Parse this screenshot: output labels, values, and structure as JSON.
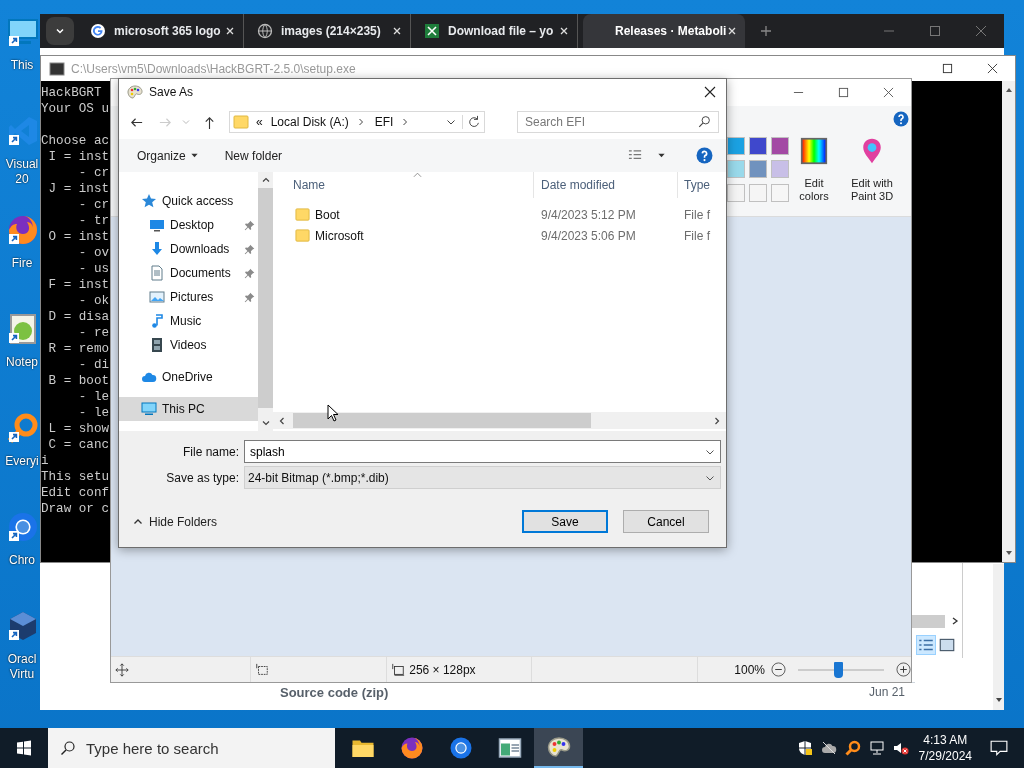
{
  "desktop_icons": [
    {
      "kind": "computer",
      "labels": [
        "This"
      ]
    },
    {
      "kind": "ribbon-app",
      "labels": [
        "Visual",
        "20"
      ]
    },
    {
      "kind": "fox-globe",
      "labels": [
        "Fire"
      ]
    },
    {
      "kind": "notepad",
      "labels": [
        "Notep"
      ]
    },
    {
      "kind": "magnifier-app",
      "labels": [
        "Everyi"
      ]
    },
    {
      "kind": "circle-app",
      "labels": [
        "Chro"
      ]
    },
    {
      "kind": "cube",
      "labels": [
        "Oracl",
        "Virtu"
      ]
    }
  ],
  "browser": {
    "tabs": [
      {
        "kind": "google",
        "label": "microsoft 365 logo",
        "selected": false
      },
      {
        "kind": "globe",
        "label": "images (214×235)",
        "selected": false
      },
      {
        "kind": "sheet",
        "label": "Download file – yo",
        "selected": false
      },
      {
        "kind": "none",
        "label": "Releases · Metaboli",
        "selected": true
      }
    ],
    "rows": [
      {
        "name": "Source code (zip)",
        "date": "Jun 21"
      }
    ]
  },
  "console": {
    "title": "C:\\Users\\vm5\\Downloads\\HackBGRT-2.5.0\\setup.exe",
    "blocks": [
      [
        "HackBGRT",
        "Your OS u"
      ],
      [
        "Choose ac",
        " I = inst",
        "     - cr",
        " J = inst",
        "     - cr",
        "     - tr",
        " O = inst",
        "     - ov",
        "     - us",
        " F = inst",
        "     - ok",
        " D = disa",
        "     - re",
        " R = remo",
        "     - di",
        " B = boot",
        "     - le",
        "     - le",
        " L = show",
        " C = canc",
        "i",
        "This setu",
        "Edit conf",
        "Draw or c"
      ]
    ]
  },
  "paint": {
    "palette": [
      {
        "color": "#1ba1e2"
      },
      {
        "color": "#3f48cc"
      },
      {
        "color": "#a349a4"
      },
      {
        "color": "#99d9ea"
      },
      {
        "color": "#7092be"
      },
      {
        "color": "#c8bfe7"
      },
      {
        "color": "#f4f4f4"
      },
      {
        "color": "#f5f5f5"
      },
      {
        "color": "#f6f6f6"
      }
    ],
    "edit_colors": "Edit colors",
    "paint3d": "Edit with Paint 3D",
    "status": {
      "size": "256 × 128px",
      "zoom": "100%",
      "zoom_slider": {
        "level": 0.47
      }
    }
  },
  "dialog": {
    "title": "Save As",
    "overflow": "«",
    "path": [
      "Local Disk (A:)",
      "EFI"
    ],
    "search": {
      "placeholder": "Search EFI"
    },
    "organize": "Organize",
    "new_folder": "New folder",
    "nav": [
      {
        "kind": "star",
        "label": "Quick access",
        "selected": false,
        "children": [
          {
            "kind": "desktop",
            "label": "Desktop",
            "pinned": true,
            "selected": false
          },
          {
            "kind": "download",
            "label": "Downloads",
            "pinned": true,
            "selected": false
          },
          {
            "kind": "document",
            "label": "Documents",
            "pinned": true,
            "selected": false
          },
          {
            "kind": "picture",
            "label": "Pictures",
            "pinned": true,
            "selected": false
          },
          {
            "kind": "music",
            "label": "Music",
            "pinned": false,
            "selected": false
          },
          {
            "kind": "film",
            "label": "Videos",
            "pinned": false,
            "selected": false
          }
        ]
      },
      {
        "kind": "cloud",
        "label": "OneDrive",
        "selected": false
      },
      {
        "kind": "computer",
        "label": "This PC",
        "selected": true
      }
    ],
    "columns": [
      "Name",
      "Date modified",
      "Type"
    ],
    "files": [
      {
        "name": "Boot",
        "date": "9/4/2023 5:12 PM",
        "type": "File f",
        "selected": false
      },
      {
        "name": "Microsoft",
        "date": "9/4/2023 5:06 PM",
        "type": "File f",
        "selected": false
      }
    ],
    "file_name": {
      "label": "File name:",
      "value": "splash"
    },
    "file_type": {
      "label": "Save as type:",
      "value": "24-bit Bitmap (*.bmp;*.dib)"
    },
    "hide_folders": "Hide Folders",
    "buttons": [
      {
        "label": "Save",
        "default": true
      },
      {
        "label": "Cancel",
        "default": false
      }
    ]
  },
  "taskbar": {
    "search": {
      "placeholder": "Type here to search"
    },
    "apps": [
      {
        "kind": "folder",
        "selected": false
      },
      {
        "kind": "fox-globe",
        "selected": false
      },
      {
        "kind": "circle-app",
        "selected": false
      },
      {
        "kind": "window-app",
        "selected": false
      },
      {
        "kind": "palette",
        "selected": true
      }
    ],
    "time": "4:13 AM",
    "date": "7/29/2024"
  }
}
